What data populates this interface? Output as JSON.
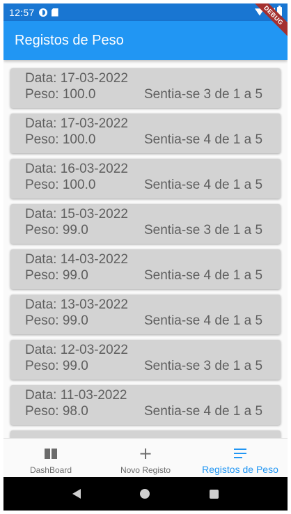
{
  "status_bar": {
    "time": "12:57"
  },
  "debug_banner": "DEBUG",
  "app_bar": {
    "title": "Registos de Peso"
  },
  "records": [
    {
      "data": "Data: 17-03-2022",
      "peso": "Peso: 100.0",
      "sentia": "Sentia-se 3 de 1 a 5"
    },
    {
      "data": "Data: 17-03-2022",
      "peso": "Peso: 100.0",
      "sentia": "Sentia-se 4 de 1 a 5"
    },
    {
      "data": "Data: 16-03-2022",
      "peso": "Peso: 100.0",
      "sentia": "Sentia-se 4 de 1 a 5"
    },
    {
      "data": "Data: 15-03-2022",
      "peso": "Peso: 99.0",
      "sentia": "Sentia-se 3 de 1 a 5"
    },
    {
      "data": "Data: 14-03-2022",
      "peso": "Peso: 99.0",
      "sentia": "Sentia-se 4 de 1 a 5"
    },
    {
      "data": "Data: 13-03-2022",
      "peso": "Peso: 99.0",
      "sentia": "Sentia-se 4 de 1 a 5"
    },
    {
      "data": "Data: 12-03-2022",
      "peso": "Peso: 99.0",
      "sentia": "Sentia-se 3 de 1 a 5"
    },
    {
      "data": "Data: 11-03-2022",
      "peso": "Peso: 98.0",
      "sentia": "Sentia-se 4 de 1 a 5"
    },
    {
      "data": "",
      "peso": "",
      "sentia": ""
    }
  ],
  "bottom_nav": {
    "items": [
      {
        "label": "DashBoard",
        "icon": "dashboard-icon",
        "active": false
      },
      {
        "label": "Novo Registo",
        "icon": "add-icon",
        "active": false
      },
      {
        "label": "Registos de Peso",
        "icon": "list-icon",
        "active": true
      }
    ]
  },
  "colors": {
    "app_bar": "#2196f3",
    "status_bar": "#1976d2",
    "card": "#d3d3d3",
    "card_text": "#5f5f5f",
    "active_nav": "#2196f3",
    "debug_banner": "#a4302f"
  }
}
